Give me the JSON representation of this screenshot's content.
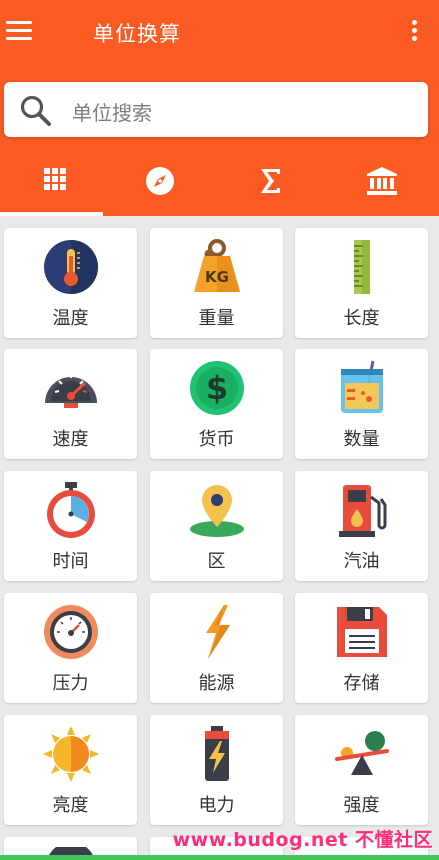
{
  "app": {
    "title": "单位换算"
  },
  "search": {
    "placeholder": "单位搜索"
  },
  "tabs": [
    {
      "name": "grid-icon",
      "active": true
    },
    {
      "name": "compass-icon",
      "active": false
    },
    {
      "name": "sigma-icon",
      "active": false
    },
    {
      "name": "bank-icon",
      "active": false
    }
  ],
  "categories": [
    {
      "label": "温度",
      "icon": "thermometer-icon"
    },
    {
      "label": "重量",
      "icon": "weight-kg-icon"
    },
    {
      "label": "长度",
      "icon": "ruler-icon"
    },
    {
      "label": "速度",
      "icon": "speedometer-icon"
    },
    {
      "label": "货币",
      "icon": "dollar-icon"
    },
    {
      "label": "数量",
      "icon": "beaker-icon"
    },
    {
      "label": "时间",
      "icon": "stopwatch-icon"
    },
    {
      "label": "区",
      "icon": "map-pin-icon"
    },
    {
      "label": "汽油",
      "icon": "fuel-pump-icon"
    },
    {
      "label": "压力",
      "icon": "pressure-gauge-icon"
    },
    {
      "label": "能源",
      "icon": "lightning-icon"
    },
    {
      "label": "存储",
      "icon": "floppy-disk-icon"
    },
    {
      "label": "亮度",
      "icon": "sun-icon"
    },
    {
      "label": "电力",
      "icon": "battery-icon"
    },
    {
      "label": "强度",
      "icon": "seesaw-icon"
    }
  ],
  "colors": {
    "accent": "#fb5a22",
    "background": "#e9e9e9"
  },
  "watermark": "www.budog.net 不懂社区"
}
